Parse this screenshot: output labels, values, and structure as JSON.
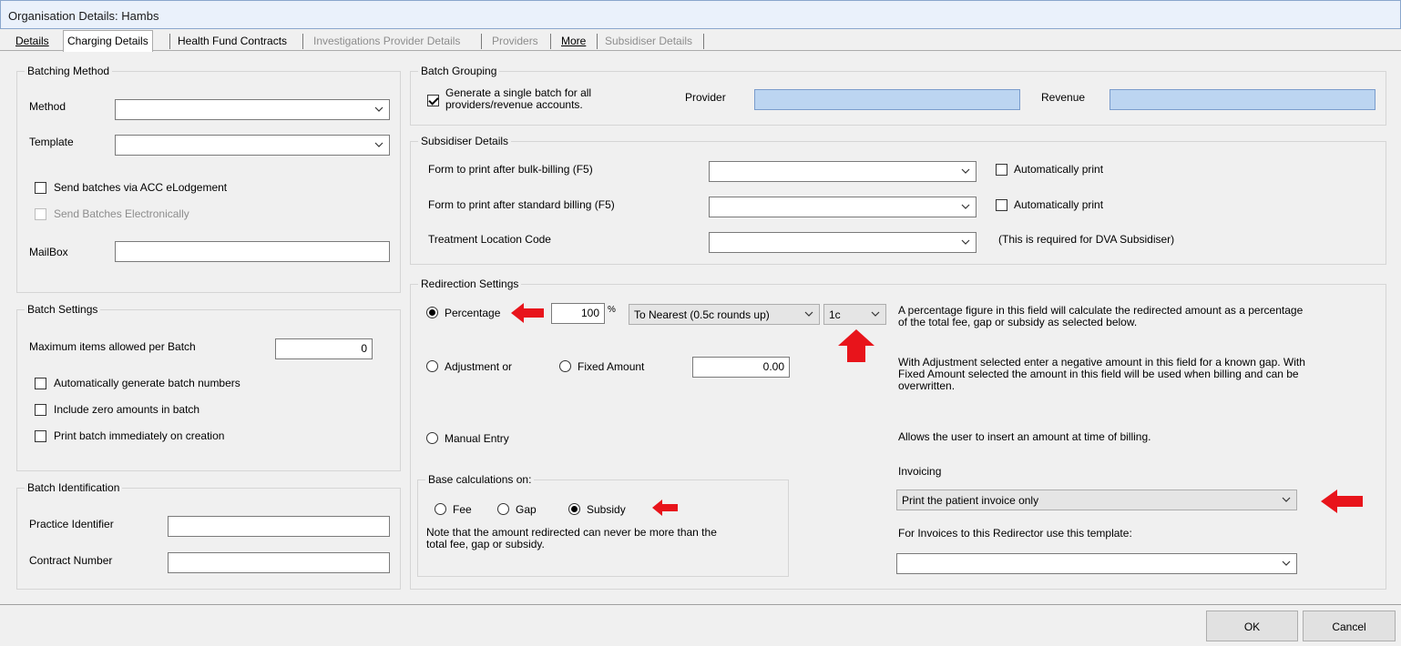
{
  "window": {
    "title": "Organisation Details: Hambs"
  },
  "tabs": [
    {
      "label": "Details"
    },
    {
      "label": "Charging Details"
    },
    {
      "label": "Health Fund Contracts"
    },
    {
      "label": "Investigations Provider Details"
    },
    {
      "label": "Providers"
    },
    {
      "label": "More"
    },
    {
      "label": "Subsidiser Details"
    }
  ],
  "batching_method": {
    "legend": "Batching Method",
    "method_label": "Method",
    "method_value": "",
    "template_label": "Template",
    "template_value": "",
    "send_acc_label": "Send batches via ACC eLodgement",
    "send_electronic_label": "Send Batches Electronically",
    "mailbox_label": "MailBox",
    "mailbox_value": ""
  },
  "batch_settings": {
    "legend": "Batch Settings",
    "max_items_label": "Maximum items allowed per Batch",
    "max_items_value": "0",
    "auto_generate_label": "Automatically generate batch numbers",
    "include_zero_label": "Include zero amounts in batch",
    "print_immediately_label": "Print batch immediately on creation"
  },
  "batch_identification": {
    "legend": "Batch Identification",
    "practice_label": "Practice Identifier",
    "practice_value": "",
    "contract_label": "Contract Number",
    "contract_value": ""
  },
  "batch_grouping": {
    "legend": "Batch Grouping",
    "single_batch_label_line1": "Generate a single batch for all",
    "single_batch_label_line2": "providers/revenue accounts.",
    "single_batch_checked": true,
    "provider_label": "Provider",
    "provider_value": "",
    "revenue_label": "Revenue",
    "revenue_value": ""
  },
  "subsidiser_details": {
    "legend": "Subsidiser Details",
    "bulk_form_label": "Form to print after bulk-billing (F5)",
    "bulk_form_value": "",
    "bulk_auto_print_label": "Automatically print",
    "standard_form_label": "Form to print after standard billing (F5)",
    "standard_form_value": "",
    "standard_auto_print_label": "Automatically print",
    "treatment_label": "Treatment Location Code",
    "treatment_value": "",
    "treatment_note": "(This is required for DVA Subsidiser)"
  },
  "redirection": {
    "legend": "Redirection Settings",
    "percentage_label": "Percentage",
    "percentage_value": "100",
    "percent_sign": "%",
    "rounding_value": "To Nearest (0.5c rounds up)",
    "rounding_unit_value": "1c",
    "percentage_note_line1": "A percentage figure in this field will calculate the redirected amount as a percentage",
    "percentage_note_line2": "of the total fee, gap or subsidy as selected below.",
    "adjustment_label": "Adjustment  or",
    "fixed_amount_label": "Fixed Amount",
    "fixed_amount_value": "0.00",
    "adjustment_note_line1": "With Adjustment selected enter a negative amount in this field for a known gap. With",
    "adjustment_note_line2": "Fixed Amount selected the amount in this field will be used when billing and can be",
    "adjustment_note_line3": "overwritten.",
    "manual_entry_label": "Manual Entry",
    "manual_note": "Allows the user to insert an amount at time of billing.",
    "base_calc": {
      "legend": "Base calculations on:",
      "fee_label": "Fee",
      "gap_label": "Gap",
      "subsidy_label": "Subsidy",
      "note_line1": "Note that the amount redirected can never be more than the",
      "note_line2": "total fee, gap or subsidy."
    },
    "invoicing_label": "Invoicing",
    "invoicing_value": "Print the patient invoice only",
    "template_label": "For Invoices to this Redirector use this template:",
    "template_value": ""
  },
  "buttons": {
    "ok": "OK",
    "cancel": "Cancel"
  },
  "colors": {
    "annotation_arrow": "#e8141b",
    "blue_field": "#bcd5f1"
  }
}
